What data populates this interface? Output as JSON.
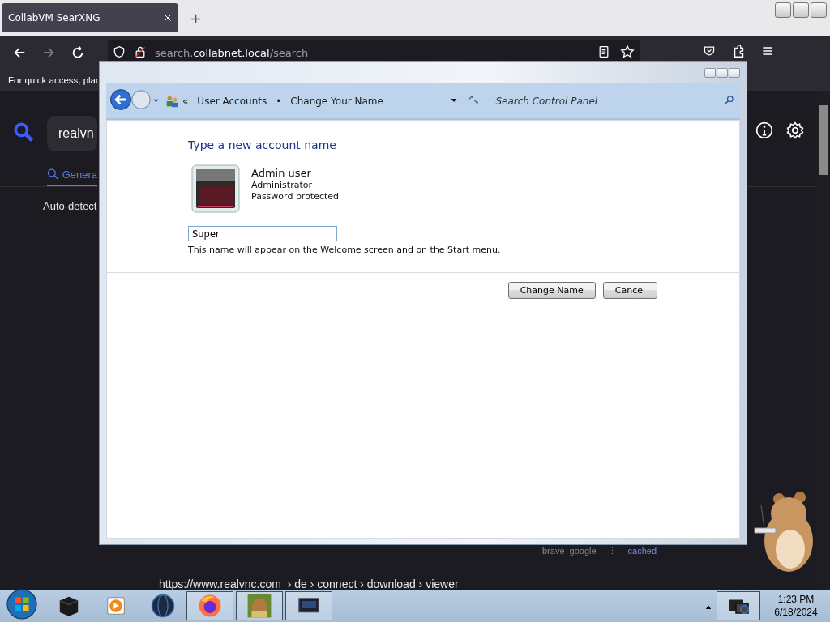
{
  "browser": {
    "tab_title": "CollabVM SearXNG",
    "new_tab": "+",
    "url": {
      "prefix": "search.",
      "host": "collabnet.local",
      "path": "/search"
    },
    "bookmarks_hint": "For quick access, plac",
    "search_query": "realvn",
    "category_tab": {
      "label": "Genera",
      "selected": true
    },
    "language": "Auto-detect",
    "result_links": [
      "brave",
      "google"
    ],
    "result_menu": "⋮",
    "cached_link": "cached",
    "result_url": "https://www.realvnc.com  › de › connect › download › viewer"
  },
  "dialog": {
    "overflow": "«",
    "breadcrumb": [
      {
        "label": "User Accounts"
      },
      {
        "label": "Change Your Name"
      }
    ],
    "separator": "•",
    "search_placeholder": "Search Control Panel",
    "heading": "Type a new account name",
    "account": {
      "name": "Admin user",
      "type": "Administrator",
      "status": "Password protected"
    },
    "name_field": {
      "value": "Super"
    },
    "hint": "This name will appear on the Welcome screen and on the Start menu.",
    "buttons": [
      "Change Name",
      "Cancel"
    ]
  },
  "taskbar": {
    "clock": {
      "time": "1:23 PM",
      "date": "6/18/2024"
    }
  }
}
